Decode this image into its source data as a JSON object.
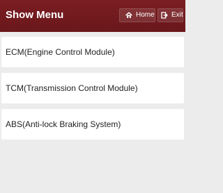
{
  "header": {
    "title": "Show Menu",
    "buttons": {
      "home": {
        "label": "Home",
        "icon": "home-icon"
      },
      "exit": {
        "label": "Exit",
        "icon": "exit-icon"
      }
    }
  },
  "menu": {
    "items": [
      {
        "label": "ECM(Engine Control Module)"
      },
      {
        "label": "TCM(Transmission Control Module)"
      },
      {
        "label": "ABS(Anti-lock Braking System)"
      }
    ]
  },
  "colors": {
    "header_bg": "#751c21",
    "content_bg": "#ececec",
    "item_bg": "#ffffff",
    "text": "#222222",
    "header_text": "#ffffff"
  }
}
